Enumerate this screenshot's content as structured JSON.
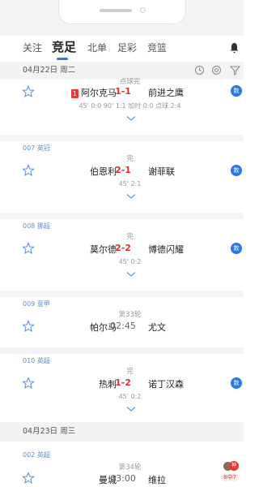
{
  "tabs": [
    "关注",
    "竞足",
    "北单",
    "足彩",
    "竞篮"
  ],
  "dates": [
    "04月22日 周二",
    "04月23日 周三"
  ],
  "matches": [
    {
      "status": "点球完",
      "home": "阿尔克马",
      "red_card": "1",
      "score": "1-1",
      "away": "前进之鹰",
      "detail": "45' 0:0 90' 1:1 加时 0:0 点球 2:4",
      "badge": "数"
    },
    {
      "league": "007 英冠",
      "status": "完",
      "home": "伯恩利",
      "score": "2-1",
      "away": "谢菲联",
      "detail": "45' 2:1",
      "badge": "数"
    },
    {
      "league": "008 挪超",
      "status": "完",
      "home": "莫尔德",
      "score": "2-2",
      "away": "博德闪耀",
      "detail": "45' 0:2",
      "badge": "数"
    },
    {
      "league": "009 意甲",
      "status": "第33轮",
      "home": "帕尔马",
      "score": "02:45",
      "away": "尤文"
    },
    {
      "league": "010 英超",
      "status": "完",
      "home": "热刺",
      "score": "1-2",
      "away": "诺丁汉森",
      "detail": "45' 0:2",
      "badge": "数"
    },
    {
      "league": "002 英超",
      "status": "第34轮",
      "home": "曼城",
      "score": "03:00",
      "away": "维拉"
    }
  ],
  "expert": {
    "label": "神",
    "tag": "8中7"
  },
  "colors": {
    "accent": "#2979e6",
    "score_red": "#e03030",
    "league_blue": "#5b8ed6"
  }
}
